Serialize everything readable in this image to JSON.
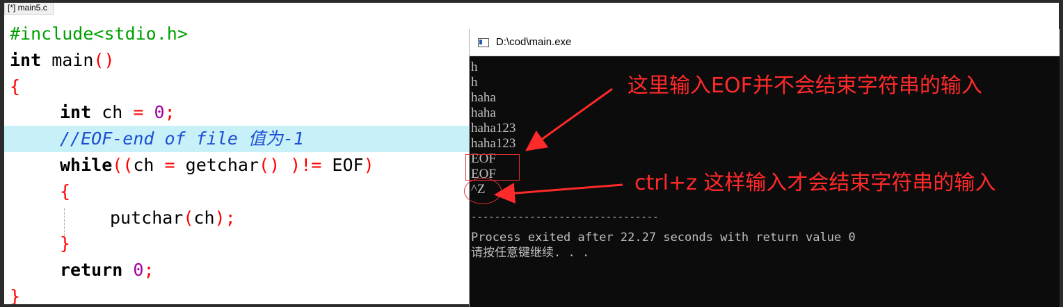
{
  "editor": {
    "file_tab": "[*] main5.c",
    "code": {
      "l1_pp": "#include<stdio.h>",
      "l2_kw": "int",
      "l2_name": " main",
      "l2_paren": "()",
      "l3_brace": "{",
      "l4_kw": "int",
      "l4_var": " ch ",
      "l4_eq": "=",
      "l4_num": "0",
      "l4_semi": ";",
      "l5_comment": "//EOF-end of file 值为-1",
      "l6_kw": "while",
      "l6_p1": "((",
      "l6_ch": "ch ",
      "l6_eq": "=",
      "l6_fn": " getchar",
      "l6_p2": "() )",
      "l6_ne": "!=",
      "l6_eof": " EOF",
      "l6_p3": ")",
      "l7_brace": "{",
      "l8_fn": "putchar",
      "l8_p1": "(",
      "l8_arg": "ch",
      "l8_p2": ")",
      "l8_semi": ";",
      "l9_brace": "}",
      "l10_kw": "return",
      "l10_num": "0",
      "l10_semi": ";",
      "l11_brace": "}"
    }
  },
  "console": {
    "title": "D:\\cod\\main.exe",
    "output_lines": [
      "h",
      "h",
      "haha",
      "haha",
      "haha123",
      "haha123",
      "EOF",
      "EOF",
      "^Z"
    ],
    "rule": "--------------------------------",
    "status_line": "Process exited after 22.27 seconds with return value 0",
    "prompt_line": "请按任意键继续. . ."
  },
  "annotations": {
    "note1": "这里输入EOF并不会结束字符串的输入",
    "note2": "ctrl+z 这样输入才会结束字符串的输入",
    "color": "#ff2a2a"
  }
}
